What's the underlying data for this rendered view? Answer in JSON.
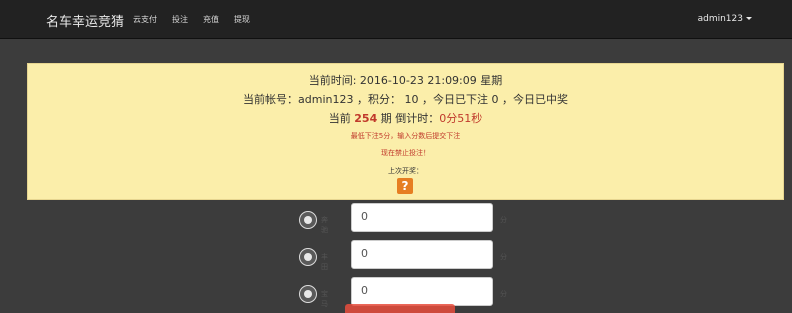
{
  "nav": {
    "brand": "名车幸运竞猜",
    "items": [
      "云支付",
      "投注",
      "充值",
      "提现"
    ],
    "user": "admin123"
  },
  "info": {
    "time_line": "当前时间: 2016-10-23  21:09:09  星期",
    "account_line": "当前帐号：admin123 ，积分： 10 ，今日已下注 0 ，今日已中奖",
    "issue_prefix": "当前",
    "issue_number": "254",
    "issue_suffix": "期 倒计时：",
    "countdown": "0分51秒",
    "min_bet_notice": "最低下注5分，输入分数后提交下注",
    "bet_closed_notice": "现在禁止投注！",
    "last_draw_label": "上次开奖：",
    "last_draw_icon": "?"
  },
  "bets": [
    {
      "label": "奔驰",
      "value": "0",
      "unit": "分",
      "icon": "benz-icon"
    },
    {
      "label": "丰田",
      "value": "0",
      "unit": "分",
      "icon": "toyota-icon"
    },
    {
      "label": "宝马",
      "value": "0",
      "unit": "分",
      "icon": "bmw-icon"
    }
  ],
  "colors": {
    "navbar": "#222222",
    "background": "#3c3c3c",
    "panel": "#fbeeaa",
    "highlight": "#c0392b",
    "question_badge": "#e67e22"
  }
}
